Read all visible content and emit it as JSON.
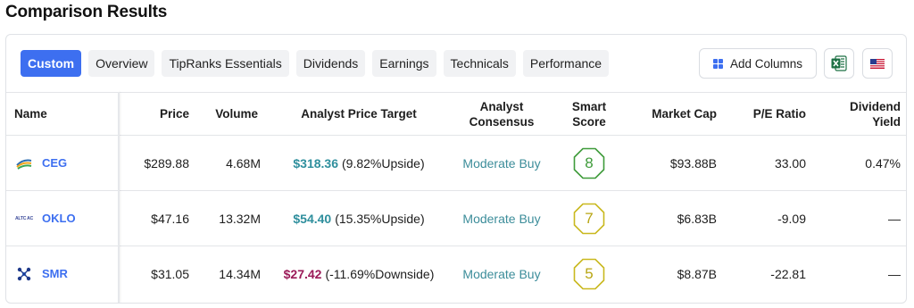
{
  "page": {
    "title": "Comparison Results"
  },
  "tabs": [
    {
      "label": "Custom",
      "active": true
    },
    {
      "label": "Overview",
      "active": false
    },
    {
      "label": "TipRanks Essentials",
      "active": false
    },
    {
      "label": "Dividends",
      "active": false
    },
    {
      "label": "Earnings",
      "active": false
    },
    {
      "label": "Technicals",
      "active": false
    },
    {
      "label": "Performance",
      "active": false
    }
  ],
  "toolbar": {
    "add_columns_label": "Add Columns",
    "add_columns_icon": "grid-icon",
    "excel_icon": "excel-icon",
    "flag_icon": "us-flag-icon"
  },
  "columns": {
    "name": "Name",
    "price": "Price",
    "volume": "Volume",
    "apt": "Analyst Price Target",
    "consensus_1": "Analyst",
    "consensus_2": "Consensus",
    "smart_1": "Smart",
    "smart_2": "Score",
    "market_cap": "Market Cap",
    "pe": "P/E Ratio",
    "div_1": "Dividend",
    "div_2": "Yield"
  },
  "rows": [
    {
      "ticker": "CEG",
      "logo_icon": "ceg-logo",
      "price": "$289.88",
      "volume": "4.68M",
      "target": "$318.36",
      "target_dir": "up",
      "upside": "(9.82%Upside)",
      "consensus": "Moderate Buy",
      "smart_score": "8",
      "market_cap": "$93.88B",
      "pe": "33.00",
      "dividend_yield": "0.47%"
    },
    {
      "ticker": "OKLO",
      "logo_icon": "oklo-logo",
      "logo_text": "ALTC AC",
      "price": "$47.16",
      "volume": "13.32M",
      "target": "$54.40",
      "target_dir": "up",
      "upside": "(15.35%Upside)",
      "consensus": "Moderate Buy",
      "smart_score": "7",
      "market_cap": "$6.83B",
      "pe": "-9.09",
      "dividend_yield": "—"
    },
    {
      "ticker": "SMR",
      "logo_icon": "smr-logo",
      "price": "$31.05",
      "volume": "14.34M",
      "target": "$27.42",
      "target_dir": "down",
      "upside": "(-11.69%Downside)",
      "consensus": "Moderate Buy",
      "smart_score": "5",
      "market_cap": "$8.87B",
      "pe": "-22.81",
      "dividend_yield": "—"
    }
  ],
  "colors": {
    "accent": "#3d6ff0",
    "upside": "#2f8f9d",
    "downside": "#9b1a58",
    "score_green": "#3e9b3a",
    "score_yellow": "#c9b81e"
  }
}
